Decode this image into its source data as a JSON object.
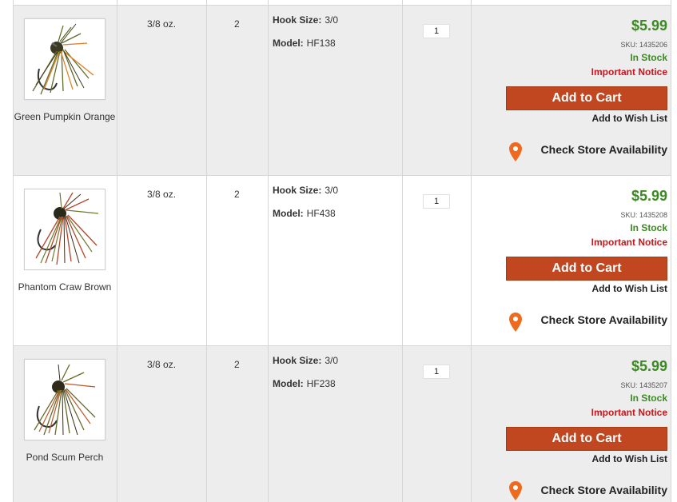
{
  "products": [
    {
      "color_name": "Green Pumpkin Orange",
      "weight": "3/8 oz.",
      "count": "2",
      "hook_size_label": "Hook Size:",
      "hook_size": "3/0",
      "model_label": "Model:",
      "model": "HF138",
      "qty": "1",
      "price": "$5.99",
      "sku": "SKU: 1435206",
      "stock": "In Stock",
      "notice": "Important Notice",
      "cart_label": "Add to Cart",
      "wish_label": "Add to Wish List",
      "store_label": "Check Store Availability",
      "skirt_colors": [
        "#5e6b2a",
        "#e07a1f",
        "#3d3b1c"
      ]
    },
    {
      "color_name": "Phantom Craw Brown",
      "weight": "3/8 oz.",
      "count": "2",
      "hook_size_label": "Hook Size:",
      "hook_size": "3/0",
      "model_label": "Model:",
      "model": "HF438",
      "qty": "1",
      "price": "$5.99",
      "sku": "SKU: 1435208",
      "stock": "In Stock",
      "notice": "Important Notice",
      "cart_label": "Add to Cart",
      "wish_label": "Add to Wish List",
      "store_label": "Check Store Availability",
      "skirt_colors": [
        "#b6452a",
        "#6e7a2e",
        "#3a2a1a"
      ]
    },
    {
      "color_name": "Pond Scum Perch",
      "weight": "3/8 oz.",
      "count": "2",
      "hook_size_label": "Hook Size:",
      "hook_size": "3/0",
      "model_label": "Model:",
      "model": "HF238",
      "qty": "1",
      "price": "$5.99",
      "sku": "SKU: 1435207",
      "stock": "In Stock",
      "notice": "Important Notice",
      "cart_label": "Add to Cart",
      "wish_label": "Add to Wish List",
      "store_label": "Check Store Availability",
      "skirt_colors": [
        "#6a6a2a",
        "#b8592a",
        "#2f2a1a"
      ]
    }
  ],
  "colors": {
    "price_green": "#3c8a23",
    "notice_red": "#c8161d",
    "cart_bg": "#c0471f",
    "pin_orange": "#ee6a1f"
  }
}
